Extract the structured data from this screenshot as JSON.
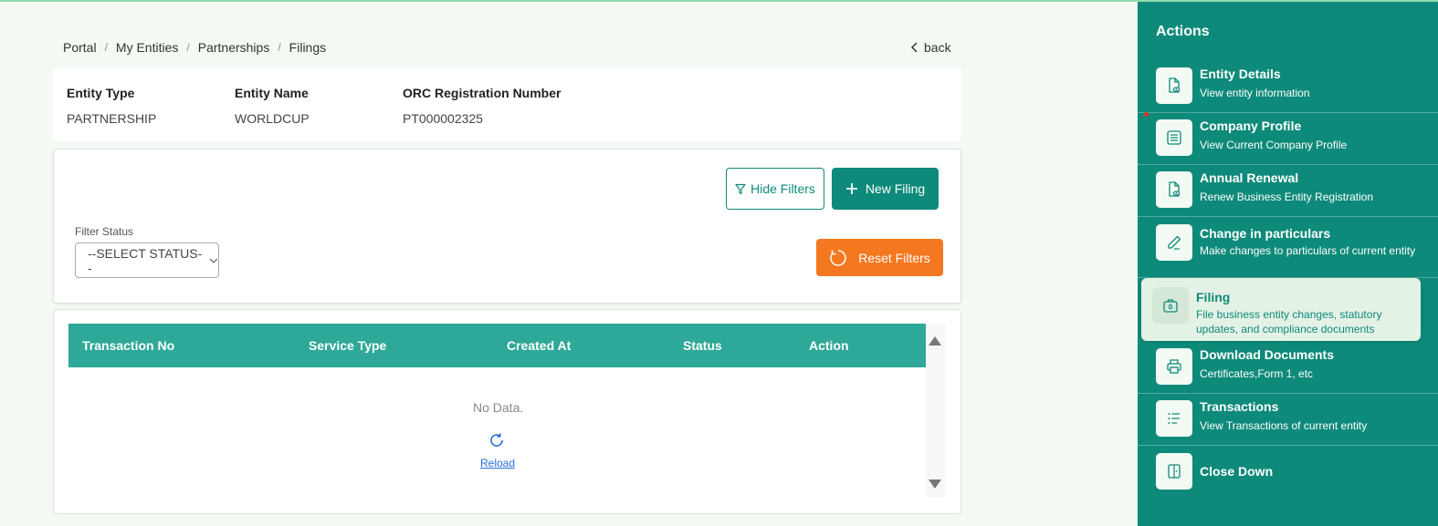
{
  "breadcrumb": {
    "items": [
      "Portal",
      "My Entities",
      "Partnerships",
      "Filings"
    ],
    "separator": "/"
  },
  "back": {
    "label": "back"
  },
  "entity": {
    "type_label": "Entity Type",
    "type_value": "PARTNERSHIP",
    "name_label": "Entity Name",
    "name_value": "WORLDCUP",
    "orc_label": "ORC Registration Number",
    "orc_value": "PT000002325"
  },
  "filters": {
    "hide_label": "Hide Filters",
    "new_label": "New Filing",
    "reset_label": "Reset Filters",
    "status_label": "Filter Status",
    "status_value": "--SELECT STATUS--"
  },
  "table": {
    "columns": [
      "Transaction No",
      "Service Type",
      "Created At",
      "Status",
      "Action"
    ],
    "empty_text": "No Data.",
    "reload_label": "Reload"
  },
  "sidebar": {
    "title": "Actions",
    "items": [
      {
        "title": "Entity Details",
        "subtitle": "View entity information",
        "icon": "doc-eye-icon"
      },
      {
        "title": "Company Profile",
        "subtitle": "View Current Company Profile",
        "icon": "list-box-icon"
      },
      {
        "title": "Annual Renewal",
        "subtitle": "Renew Business Entity Registration",
        "icon": "doc-eye-icon"
      },
      {
        "title": "Change in particulars",
        "subtitle": "Make changes to particulars of current entity",
        "icon": "pencil-icon"
      },
      {
        "title": "Filing",
        "subtitle": "File business entity changes, statutory updates, and compliance documents",
        "icon": "briefcase-icon"
      },
      {
        "title": "Download Documents",
        "subtitle": "Certificates,Form 1, etc",
        "icon": "printer-icon"
      },
      {
        "title": "Transactions",
        "subtitle": "View Transactions of current entity",
        "icon": "list-icon"
      },
      {
        "title": "Close Down",
        "subtitle": "",
        "icon": "door-icon"
      }
    ]
  },
  "colors": {
    "primary": "#0e8a7a",
    "table_header": "#2ea898",
    "orange": "#f47820",
    "background": "#f3faf3"
  }
}
